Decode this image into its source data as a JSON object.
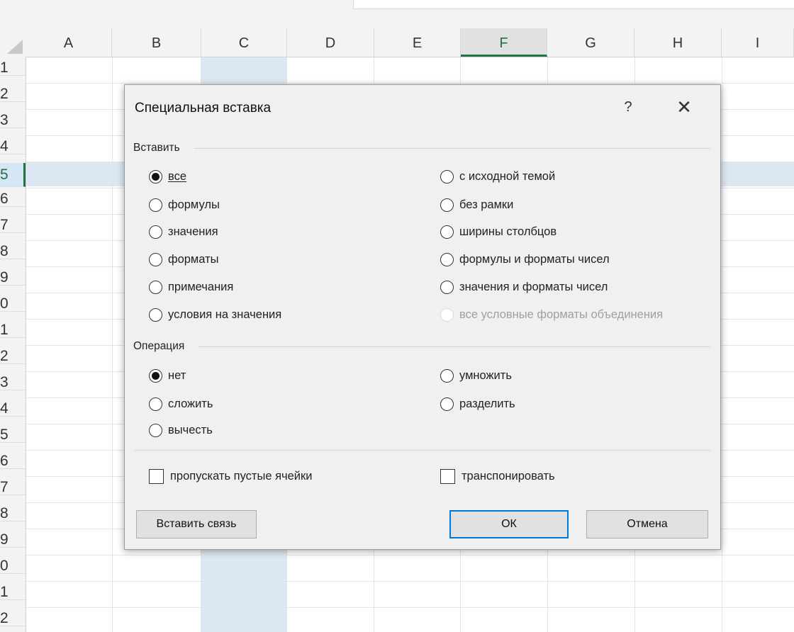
{
  "sheet": {
    "columns": [
      "A",
      "B",
      "C",
      "D",
      "E",
      "F",
      "G",
      "H",
      "I"
    ],
    "active_column": "F",
    "row_numbers": [
      "1",
      "2",
      "3",
      "4",
      "5",
      "6",
      "7",
      "8",
      "9",
      "0",
      "1",
      "2",
      "3",
      "4",
      "5",
      "6",
      "7",
      "8",
      "9",
      "0",
      "1",
      "2"
    ],
    "active_row_index": 4
  },
  "dialog": {
    "title": "Специальная вставка",
    "help_label": "?",
    "close_label": "✕",
    "paste_group": {
      "label": "Вставить",
      "left_options": [
        {
          "label": "все",
          "checked": true
        },
        {
          "label": "формулы",
          "checked": false
        },
        {
          "label": "значения",
          "checked": false
        },
        {
          "label": "форматы",
          "checked": false
        },
        {
          "label": "примечания",
          "checked": false
        },
        {
          "label": "условия на значения",
          "checked": false
        }
      ],
      "right_options": [
        {
          "label": "с исходной темой",
          "checked": false,
          "disabled": false
        },
        {
          "label": "без рамки",
          "checked": false,
          "disabled": false
        },
        {
          "label": "ширины столбцов",
          "checked": false,
          "disabled": false
        },
        {
          "label": "формулы и форматы чисел",
          "checked": false,
          "disabled": false
        },
        {
          "label": "значения и форматы чисел",
          "checked": false,
          "disabled": false
        },
        {
          "label": "все условные форматы объединения",
          "checked": false,
          "disabled": true
        }
      ]
    },
    "operation_group": {
      "label": "Операция",
      "left_options": [
        {
          "label": "нет",
          "checked": true
        },
        {
          "label": "сложить",
          "checked": false
        },
        {
          "label": "вычесть",
          "checked": false
        }
      ],
      "right_options": [
        {
          "label": "умножить",
          "checked": false
        },
        {
          "label": "разделить",
          "checked": false
        }
      ]
    },
    "skip_blanks_label": "пропускать пустые ячейки",
    "transpose_label": "транспонировать",
    "paste_link_button": "Вставить связь",
    "ok_button": "ОК",
    "cancel_button": "Отмена"
  },
  "colors": {
    "excel_green": "#217346",
    "selection_blue": "#dbe8f4",
    "default_button_border": "#0078d7"
  }
}
